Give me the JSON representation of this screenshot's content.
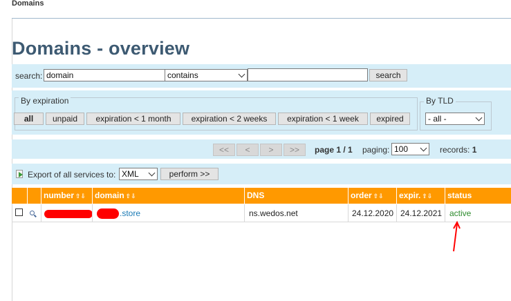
{
  "breadcrumb": "Domains",
  "page_title": "Domains - overview",
  "search": {
    "label": "search:",
    "field_value": "domain",
    "operator_value": "contains",
    "query_value": "",
    "button": "search"
  },
  "filters": {
    "expiration_legend": "By expiration",
    "expiration_buttons": [
      "all",
      "unpaid",
      "expiration < 1 month",
      "expiration < 2 weeks",
      "expiration < 1 week",
      "expired"
    ],
    "active_filter": "all",
    "tld_legend": "By TLD",
    "tld_value": "- all -"
  },
  "pager": {
    "first": "<<",
    "prev": "<",
    "next": ">",
    "last": ">>",
    "page_label": "page",
    "page_value": "1 / 1",
    "paging_label": "paging:",
    "paging_value": "100",
    "records_label": "records:",
    "records_value": "1"
  },
  "export": {
    "label": "Export of all services to:",
    "format": "XML",
    "button": "perform >>"
  },
  "table": {
    "headers": [
      "number",
      "domain",
      "DNS",
      "order",
      "expir.",
      "status"
    ],
    "sort_icon": "up-down-arrows",
    "rows": [
      {
        "domain_suffix": ".store",
        "dns": "ns.wedos.net",
        "order": "24.12.2020",
        "expiration": "24.12.2021",
        "status": "active"
      }
    ]
  },
  "colors": {
    "header_orange": "#ff9900",
    "panel_blue": "#d6eef8",
    "title_blue": "#3d5a72",
    "status_green": "#2c8a2c",
    "annotation_red": "#ff0000"
  }
}
